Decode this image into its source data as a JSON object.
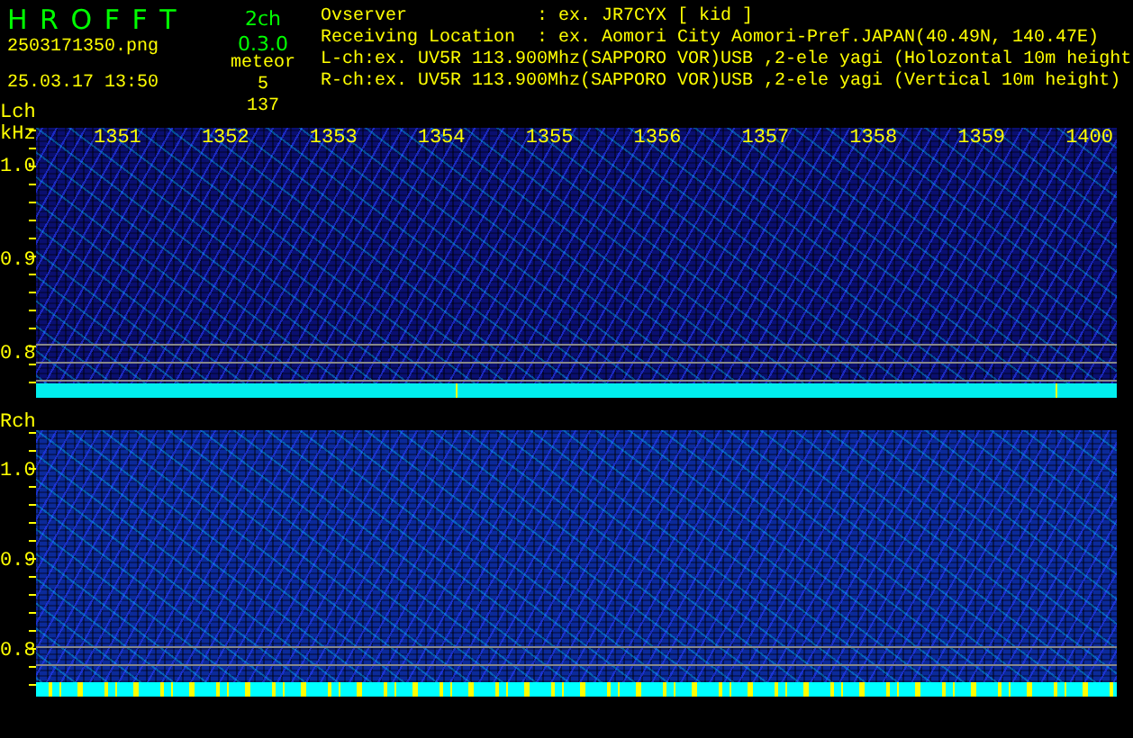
{
  "header": {
    "logo": "H R O F F T",
    "version": "2ch 0.3.0",
    "filename": "2503171350.png",
    "mode": "meteor",
    "lch_count": "5",
    "timestamp": "25.03.17 13:50",
    "rch_count": "137"
  },
  "info": [
    {
      "kind": "field",
      "label": "Ovserver",
      "value": ": ex. JR7CYX [ kid ]"
    },
    {
      "kind": "field",
      "label": "Receiving Location",
      "value": ": ex. Aomori City Aomori-Pref.JAPAN(40.49N, 140.47E)"
    },
    {
      "kind": "line",
      "text": "L-ch:ex. UV5R 113.900Mhz(SAPPORO VOR)USB ,2-ele yagi (Holozontal 10m height"
    },
    {
      "kind": "line",
      "text": "R-ch:ex. UV5R 113.900Mhz(SAPPORO VOR)USB ,2-ele yagi (Vertical 10m height)"
    }
  ],
  "panels": [
    {
      "channel": "Lch",
      "unit": "kHz",
      "time_labels": [
        "1351",
        "1352",
        "1353",
        "1354",
        "1355",
        "1356",
        "1357",
        "1358",
        "1359",
        "1400"
      ],
      "freq_labels": [
        "1.0",
        "0.9",
        "0.8"
      ]
    },
    {
      "channel": "Rch",
      "freq_labels": [
        "1.0",
        "0.9",
        "0.8"
      ]
    }
  ]
}
